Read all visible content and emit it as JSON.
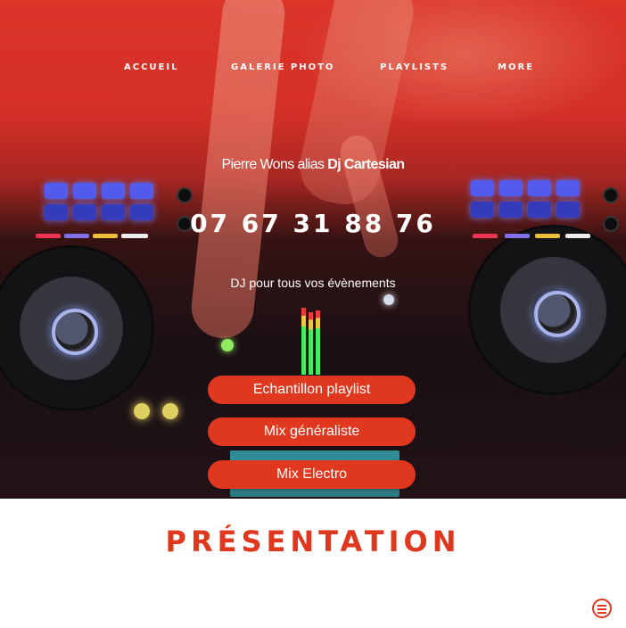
{
  "nav": {
    "items": [
      "ACCUEIL",
      "GALERIE PHOTO",
      "PLAYLISTS",
      "MORE"
    ]
  },
  "hero": {
    "name_prefix": "Pierre Wons alias ",
    "name_bold": "Dj Cartesian",
    "phone": "07 67 31 88 76",
    "tagline": "DJ pour tous vos évènements"
  },
  "buttons": {
    "sample": "Echantillon playlist",
    "general": "Mix généraliste",
    "electro": "Mix Electro"
  },
  "presentation": {
    "title": "PRÉSENTATION"
  },
  "colors": {
    "accent": "#e0381f",
    "hero_red": "#e8352b"
  },
  "icons": {
    "chat": "chat-bubble-icon"
  }
}
